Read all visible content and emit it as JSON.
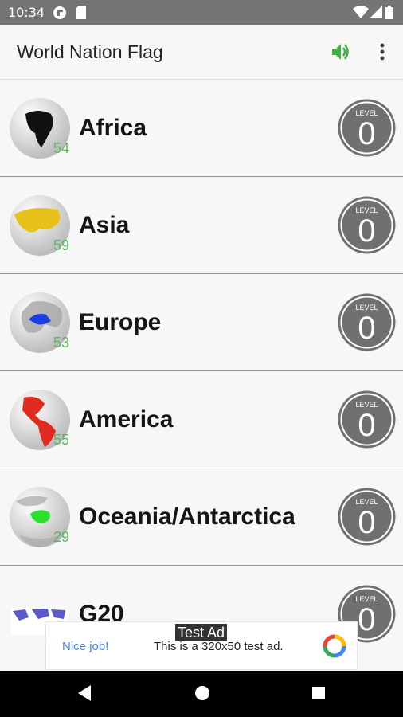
{
  "status_bar": {
    "time": "10:34"
  },
  "app_bar": {
    "title": "World Nation Flag"
  },
  "regions": [
    {
      "name": "Africa",
      "count": "54",
      "level_caption": "LEVEL",
      "level": "0",
      "globe_color": "#111111"
    },
    {
      "name": "Asia",
      "count": "59",
      "level_caption": "LEVEL",
      "level": "0",
      "globe_color": "#e6c21a"
    },
    {
      "name": "Europe",
      "count": "53",
      "level_caption": "LEVEL",
      "level": "0",
      "globe_color": "#1a3ee0"
    },
    {
      "name": "America",
      "count": "55",
      "level_caption": "LEVEL",
      "level": "0",
      "globe_color": "#e02a1f"
    },
    {
      "name": "Oceania/Antarctica",
      "count": "29",
      "level_caption": "LEVEL",
      "level": "0",
      "globe_color": "#2ee02e"
    },
    {
      "name": "G20",
      "count": "",
      "level_caption": "LEVEL",
      "level": "0",
      "globe_color": "#5a5acc"
    }
  ],
  "ad": {
    "label": "Test Ad",
    "nice": "Nice job!",
    "text": "This is a 320x50 test ad."
  },
  "colors": {
    "accent_green": "#5cb85c",
    "status_bar": "#757575",
    "badge_gray": "#707070"
  }
}
